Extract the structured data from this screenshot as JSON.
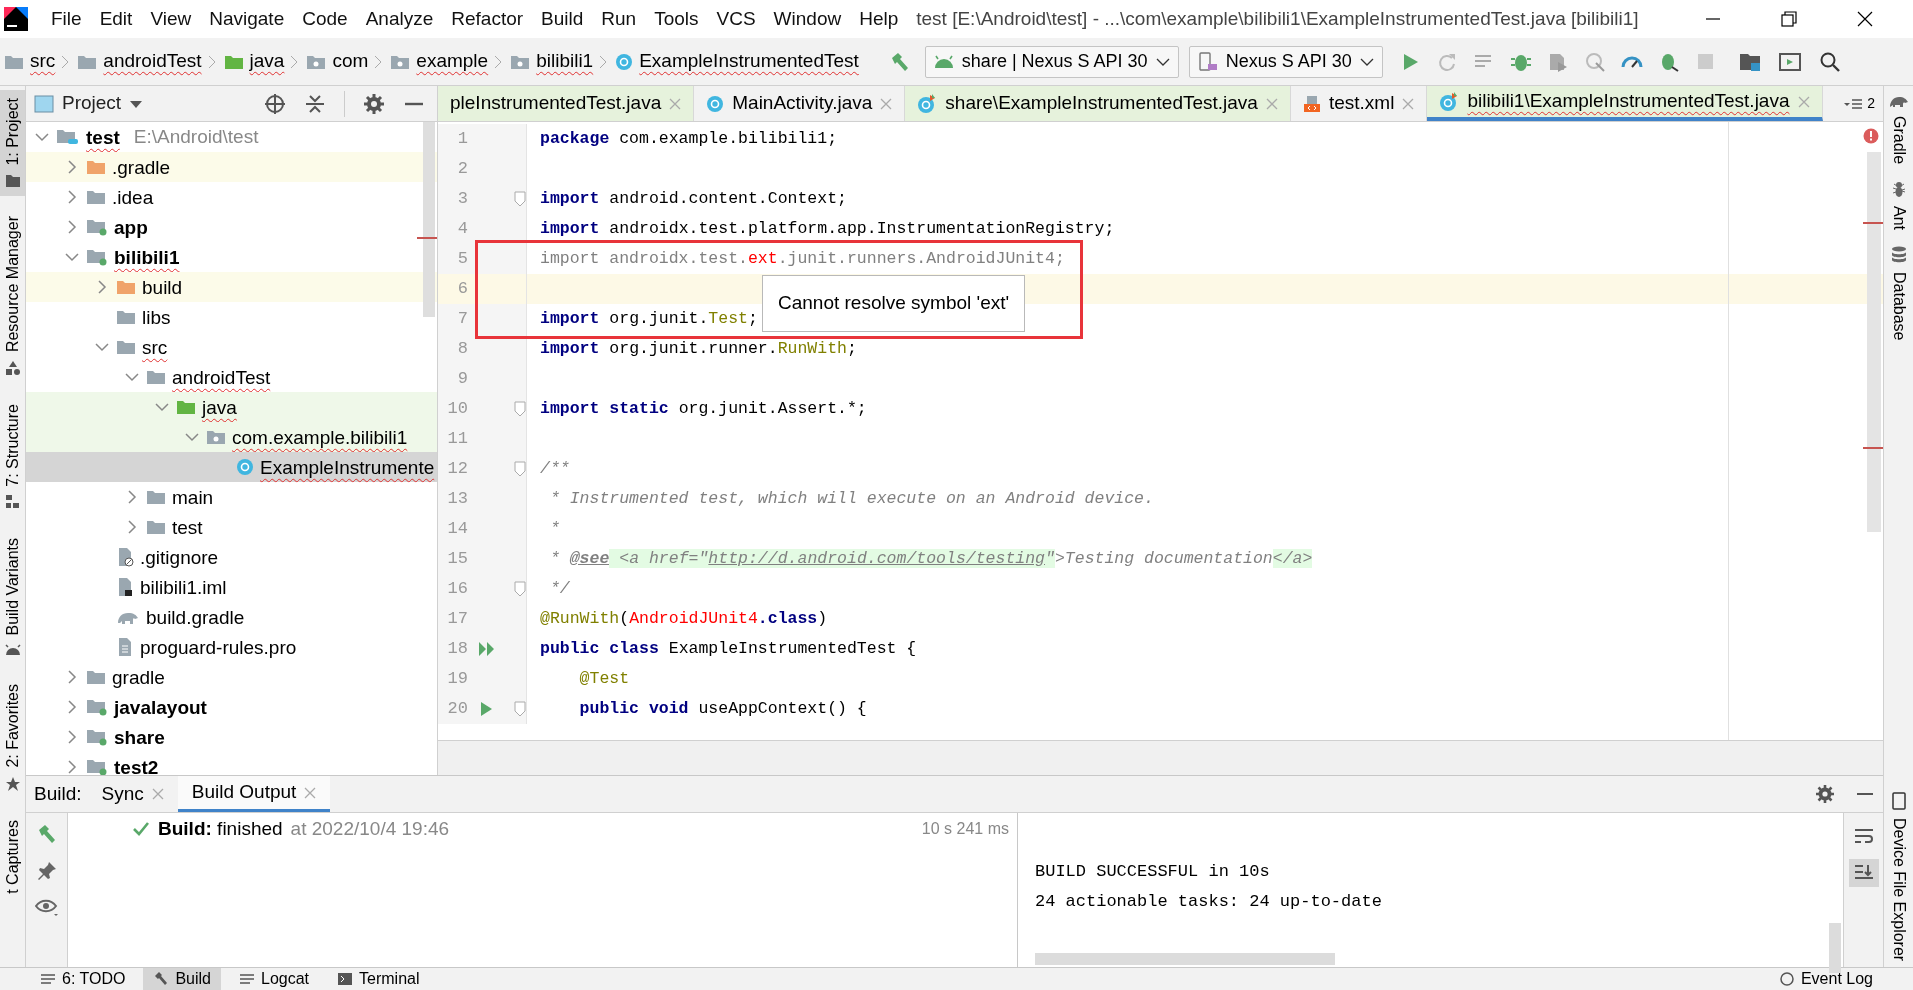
{
  "window": {
    "title": "test [E:\\Android\\test] - ...\\com\\example\\bilibili1\\ExampleInstrumentedTest.java [bilibili1]"
  },
  "menu": [
    "File",
    "Edit",
    "View",
    "Navigate",
    "Code",
    "Analyze",
    "Refactor",
    "Build",
    "Run",
    "Tools",
    "VCS",
    "Window",
    "Help"
  ],
  "breadcrumbs": [
    {
      "label": "src",
      "kind": "folder",
      "misspelled": true
    },
    {
      "label": "androidTest",
      "kind": "folder",
      "misspelled": true
    },
    {
      "label": "java",
      "kind": "test-folder",
      "misspelled": true
    },
    {
      "label": "com",
      "kind": "package",
      "misspelled": false
    },
    {
      "label": "example",
      "kind": "package",
      "misspelled": true
    },
    {
      "label": "bilibili1",
      "kind": "package",
      "misspelled": true
    },
    {
      "label": "ExampleInstrumentedTest",
      "kind": "class",
      "misspelled": true
    }
  ],
  "toolbar": {
    "run_config": "share | Nexus S API 30",
    "device": "Nexus S API 30"
  },
  "left_tool_windows": [
    {
      "label": "1: Project",
      "kind": "folder",
      "selected": true
    },
    {
      "label": "Resource Manager",
      "kind": "shapes",
      "selected": false
    },
    {
      "label": "7: Structure",
      "kind": "structure",
      "selected": false
    },
    {
      "label": "Build Variants",
      "kind": "android",
      "selected": false
    },
    {
      "label": "2: Favorites",
      "kind": "star",
      "selected": false
    },
    {
      "label": "t Captures",
      "kind": "none",
      "selected": false
    }
  ],
  "project_panel": {
    "title": "Project",
    "tree": [
      {
        "label": "test",
        "path": "E:\\Android\\test",
        "kind": "root",
        "bold": true,
        "misspelled": true,
        "expanded": true,
        "selected": false,
        "children": [
          {
            "label": ".gradle",
            "kind": "excluded-folder",
            "expanded": false,
            "selected": false,
            "excluded": true
          },
          {
            "label": ".idea",
            "kind": "folder",
            "expanded": false,
            "selected": false
          },
          {
            "label": "app",
            "kind": "module",
            "bold": true,
            "expanded": false,
            "selected": false
          },
          {
            "label": "bilibili1",
            "kind": "module",
            "bold": true,
            "misspelled": true,
            "expanded": true,
            "selected": false,
            "children": [
              {
                "label": "build",
                "kind": "excluded-folder",
                "expanded": false,
                "selected": false,
                "excluded": true
              },
              {
                "label": "libs",
                "kind": "folder",
                "selected": false
              },
              {
                "label": "src",
                "kind": "folder",
                "misspelled": true,
                "expanded": true,
                "selected": false,
                "children": [
                  {
                    "label": "androidTest",
                    "kind": "folder",
                    "misspelled": true,
                    "expanded": true,
                    "selected": false,
                    "children": [
                      {
                        "label": "java",
                        "kind": "test-folder",
                        "misspelled": true,
                        "expanded": true,
                        "selected": false,
                        "test_source": true,
                        "children": [
                          {
                            "label": "com.example.bilibili1",
                            "kind": "package",
                            "misspelled": true,
                            "expanded": true,
                            "selected": false,
                            "test_source": true,
                            "children": [
                              {
                                "label": "ExampleInstrumente",
                                "kind": "class",
                                "misspelled": true,
                                "selected": true
                              }
                            ]
                          }
                        ]
                      }
                    ]
                  },
                  {
                    "label": "main",
                    "kind": "folder",
                    "expanded": false,
                    "selected": false
                  },
                  {
                    "label": "test",
                    "kind": "folder",
                    "expanded": false,
                    "selected": false
                  }
                ]
              },
              {
                "label": ".gitignore",
                "kind": "ignore-file",
                "selected": false
              },
              {
                "label": "bilibili1.iml",
                "kind": "iml-file",
                "selected": false
              },
              {
                "label": "build.gradle",
                "kind": "gradle-file",
                "selected": false
              },
              {
                "label": "proguard-rules.pro",
                "kind": "text-file",
                "selected": false
              }
            ]
          },
          {
            "label": "gradle",
            "kind": "folder",
            "expanded": false,
            "selected": false
          },
          {
            "label": "javalayout",
            "kind": "module",
            "bold": true,
            "expanded": false,
            "selected": false
          },
          {
            "label": "share",
            "kind": "module",
            "bold": true,
            "expanded": false,
            "selected": false
          },
          {
            "label": "test2",
            "kind": "module",
            "bold": true,
            "expanded": false,
            "selected": false
          }
        ]
      }
    ]
  },
  "editor": {
    "tabs": [
      {
        "label": "pleInstrumentedTest.java",
        "kind": "none",
        "test_source": true,
        "selected": false
      },
      {
        "label": "MainActivity.java",
        "kind": "class",
        "test_source": false,
        "selected": false
      },
      {
        "label": "share\\ExampleInstrumentedTest.java",
        "kind": "test-class",
        "test_source": true,
        "selected": false
      },
      {
        "label": "test.xml",
        "kind": "xml",
        "test_source": false,
        "selected": false
      },
      {
        "label": "bilibili1\\ExampleInstrumentedTest.java",
        "kind": "test-class",
        "test_source": true,
        "selected": true
      }
    ],
    "overflow_count": "2",
    "lines": [
      {
        "n": "1",
        "tokens": [
          {
            "kind": "kw",
            "text": "package"
          },
          {
            "kind": "plain",
            "text": " com.example.bilibili1;"
          }
        ]
      },
      {
        "n": "2"
      },
      {
        "n": "3",
        "kind": "fold",
        "tokens": [
          {
            "kind": "kw",
            "text": "import"
          },
          {
            "kind": "plain",
            "text": " android.content.Context;"
          }
        ]
      },
      {
        "n": "4",
        "tokens": [
          {
            "kind": "kw",
            "text": "import"
          },
          {
            "kind": "plain",
            "text": " androidx.test.platform.app.InstrumentationRegistry;"
          }
        ]
      },
      {
        "n": "5",
        "tokens": [
          {
            "kind": "gray",
            "text": "import androidx.test."
          },
          {
            "kind": "err",
            "text": "ext"
          },
          {
            "kind": "gray",
            "text": ".junit.runners.AndroidJUnit4;"
          }
        ]
      },
      {
        "n": "6",
        "current": true
      },
      {
        "n": "7",
        "tokens": [
          {
            "kind": "kw",
            "text": "import"
          },
          {
            "kind": "plain",
            "text": " org.junit."
          },
          {
            "kind": "annot",
            "text": "Test"
          },
          {
            "kind": "plain",
            "text": ";"
          }
        ]
      },
      {
        "n": "8",
        "tokens": [
          {
            "kind": "kw",
            "text": "import"
          },
          {
            "kind": "plain",
            "text": " org.junit.runner."
          },
          {
            "kind": "annot",
            "text": "RunWith"
          },
          {
            "kind": "plain",
            "text": ";"
          }
        ]
      },
      {
        "n": "9"
      },
      {
        "n": "10",
        "kind": "fold",
        "tokens": [
          {
            "kind": "kw",
            "text": "import static"
          },
          {
            "kind": "plain",
            "text": " org.junit.Assert.*;"
          }
        ]
      },
      {
        "n": "11"
      },
      {
        "n": "12",
        "kind": "fold",
        "tokens": [
          {
            "kind": "doc",
            "text": "/**"
          }
        ]
      },
      {
        "n": "13",
        "tokens": [
          {
            "kind": "doc",
            "text": " * Instrumented test, which will execute on an Android device."
          }
        ]
      },
      {
        "n": "14",
        "tokens": [
          {
            "kind": "doc",
            "text": " *"
          }
        ]
      },
      {
        "n": "15",
        "tokens": [
          {
            "kind": "doc",
            "text": " * "
          },
          {
            "kind": "doctag",
            "text": "@see"
          },
          {
            "kind": "html",
            "text": " <a href=\""
          },
          {
            "kind": "link",
            "text": "http://d.android.com/tools/testing"
          },
          {
            "kind": "html",
            "text": "\""
          },
          {
            "kind": "doc",
            "text": ">Testing documentation"
          },
          {
            "kind": "html",
            "text": "</a>"
          }
        ]
      },
      {
        "n": "16",
        "kind": "fold",
        "tokens": [
          {
            "kind": "doc",
            "text": " */"
          }
        ]
      },
      {
        "n": "17",
        "tokens": [
          {
            "kind": "annot",
            "text": "@RunWith"
          },
          {
            "kind": "plain",
            "text": "("
          },
          {
            "kind": "err",
            "text": "AndroidJUnit4"
          },
          {
            "kind": "kw",
            "text": ".class"
          },
          {
            "kind": "plain",
            "text": ")"
          }
        ]
      },
      {
        "n": "18",
        "kind": "run-all",
        "tokens": [
          {
            "kind": "kw",
            "text": "public class"
          },
          {
            "kind": "plain",
            "text": " ExampleInstrumentedTest {"
          }
        ]
      },
      {
        "n": "19",
        "tokens": [
          {
            "kind": "annot",
            "text": "    @Test"
          }
        ]
      },
      {
        "n": "20",
        "kind": "run",
        "tokens": [
          {
            "kind": "kw",
            "text": "    public void"
          },
          {
            "kind": "plain",
            "text": " useAppContext() {"
          }
        ]
      }
    ],
    "tooltip": "Cannot resolve symbol 'ext'"
  },
  "right_tool_windows": [
    {
      "label": "Gradle",
      "kind": "elephant"
    },
    {
      "label": "Ant",
      "kind": "ant"
    },
    {
      "label": "Database",
      "kind": "database"
    },
    {
      "label": "Device File Explorer",
      "kind": "phone"
    }
  ],
  "build_panel": {
    "label": "Build:",
    "tabs": [
      {
        "label": "Sync",
        "selected": false
      },
      {
        "label": "Build Output",
        "selected": true
      }
    ],
    "event": {
      "text": "**Build:** finished",
      "time": "at 2022/10/4 19:46",
      "duration": "10 s 241 ms"
    },
    "console": [
      "BUILD SUCCESSFUL in 10s",
      "24 actionable tasks: 24 up-to-date"
    ]
  },
  "bottom_tabs": [
    {
      "label": "6: TODO",
      "kind": "list",
      "selected": false
    },
    {
      "label": "Build",
      "kind": "hammer",
      "selected": true
    },
    {
      "label": "Logcat",
      "kind": "list",
      "selected": false
    },
    {
      "label": "Terminal",
      "kind": "terminal",
      "selected": false
    }
  ],
  "event_log": "Event Log"
}
